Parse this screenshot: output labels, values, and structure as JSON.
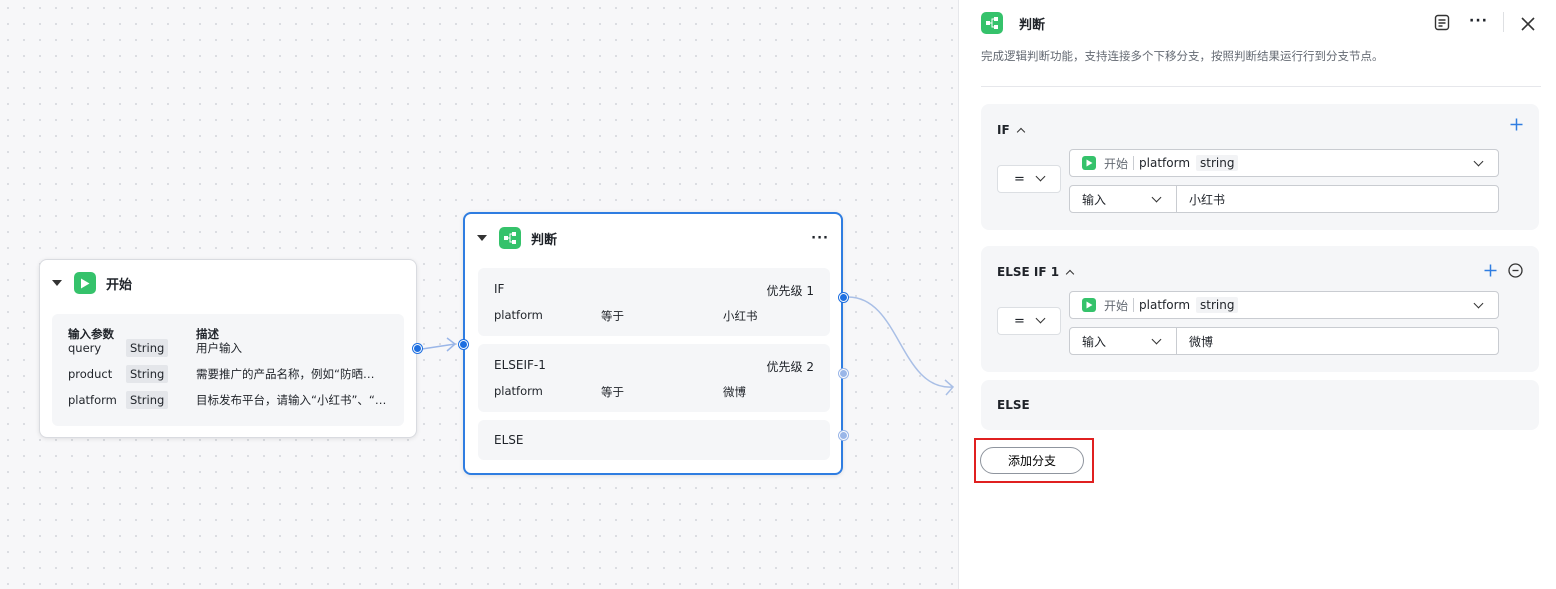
{
  "start_node": {
    "title": "开始",
    "header_col1": "输入参数",
    "header_col2": "描述",
    "params": [
      {
        "name": "query",
        "type": "String",
        "desc": "用户输入"
      },
      {
        "name": "product",
        "type": "String",
        "desc": "需要推广的产品名称，例如“防晒…"
      },
      {
        "name": "platform",
        "type": "String",
        "desc": "目标发布平台，请输入“小红书”、“…"
      }
    ]
  },
  "condition_node": {
    "title": "判断",
    "more": "···",
    "branches": [
      {
        "title": "IF",
        "priority": "优先级 1",
        "var": "platform",
        "op": "等于",
        "value": "小红书"
      },
      {
        "title": "ELSEIF-1",
        "priority": "优先级 2",
        "var": "platform",
        "op": "等于",
        "value": "微博"
      },
      {
        "title": "ELSE"
      }
    ]
  },
  "panel": {
    "title": "判断",
    "description": "完成逻辑判断功能，支持连接多个下移分支，按照判断结果运行行到分支节点。",
    "cards": [
      {
        "title": "IF",
        "operator": "=",
        "source": "开始",
        "variable": "platform",
        "var_type": "string",
        "value_type": "输入",
        "value": "小红书"
      },
      {
        "title": "ELSE IF 1",
        "operator": "=",
        "source": "开始",
        "variable": "platform",
        "var_type": "string",
        "value_type": "输入",
        "value": "微博"
      }
    ],
    "else_title": "ELSE",
    "add_branch_label": "添加分支"
  },
  "colors": {
    "accent": "#2f7de1",
    "node_icon": "#35c26b",
    "highlight": "#e02020"
  }
}
